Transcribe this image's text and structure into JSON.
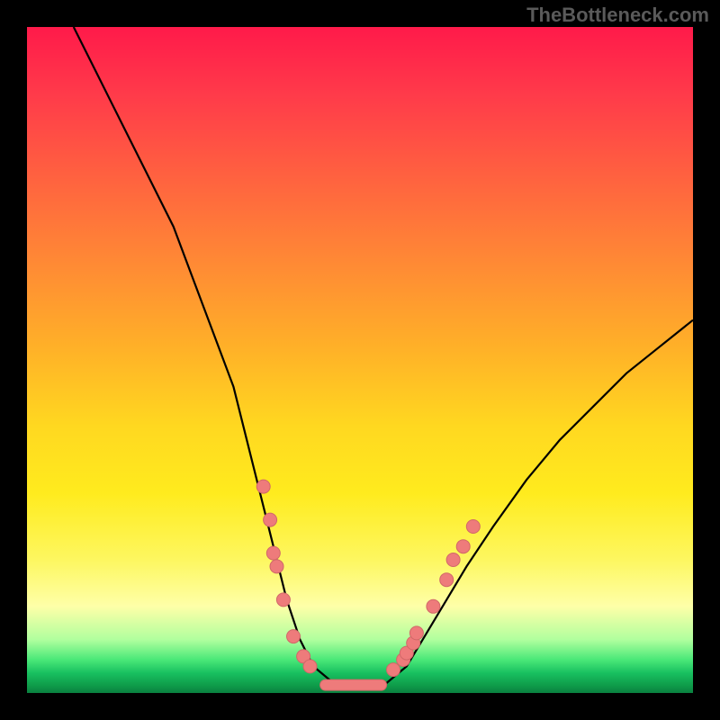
{
  "watermark": "TheBottleneck.com",
  "chart_data": {
    "type": "line",
    "title": "",
    "xlabel": "",
    "ylabel": "",
    "xlim": [
      0,
      100
    ],
    "ylim": [
      0,
      100
    ],
    "curve": {
      "name": "bottleneck-curve",
      "points_xy": [
        [
          7,
          100
        ],
        [
          10,
          94
        ],
        [
          14,
          86
        ],
        [
          18,
          78
        ],
        [
          22,
          70
        ],
        [
          25,
          62
        ],
        [
          28,
          54
        ],
        [
          31,
          46
        ],
        [
          33,
          38
        ],
        [
          35,
          30
        ],
        [
          37,
          22
        ],
        [
          39,
          14
        ],
        [
          41,
          8
        ],
        [
          43,
          4
        ],
        [
          46,
          1.5
        ],
        [
          48,
          1
        ],
        [
          50,
          1
        ],
        [
          52,
          1
        ],
        [
          54,
          1.5
        ],
        [
          57,
          4
        ],
        [
          60,
          9
        ],
        [
          63,
          14
        ],
        [
          66,
          19
        ],
        [
          70,
          25
        ],
        [
          75,
          32
        ],
        [
          80,
          38
        ],
        [
          85,
          43
        ],
        [
          90,
          48
        ],
        [
          95,
          52
        ],
        [
          100,
          56
        ]
      ]
    },
    "markers_left": [
      [
        35.5,
        31
      ],
      [
        36.5,
        26
      ],
      [
        37,
        21
      ],
      [
        37.5,
        19
      ],
      [
        38.5,
        14
      ],
      [
        40,
        8.5
      ],
      [
        41.5,
        5.5
      ],
      [
        42.5,
        4
      ]
    ],
    "markers_right": [
      [
        55,
        3.5
      ],
      [
        56.5,
        5
      ],
      [
        57,
        6
      ],
      [
        58,
        7.5
      ],
      [
        58.5,
        9
      ],
      [
        61,
        13
      ],
      [
        63,
        17
      ],
      [
        64,
        20
      ],
      [
        65.5,
        22
      ],
      [
        67,
        25
      ]
    ],
    "flat_segment": {
      "x1": 44,
      "x2": 54,
      "y": 1.2
    },
    "colors": {
      "curve": "#000000",
      "marker_fill": "#ee7b7b",
      "marker_stroke": "#d06868",
      "flat_fill": "#ee7b7b"
    }
  }
}
